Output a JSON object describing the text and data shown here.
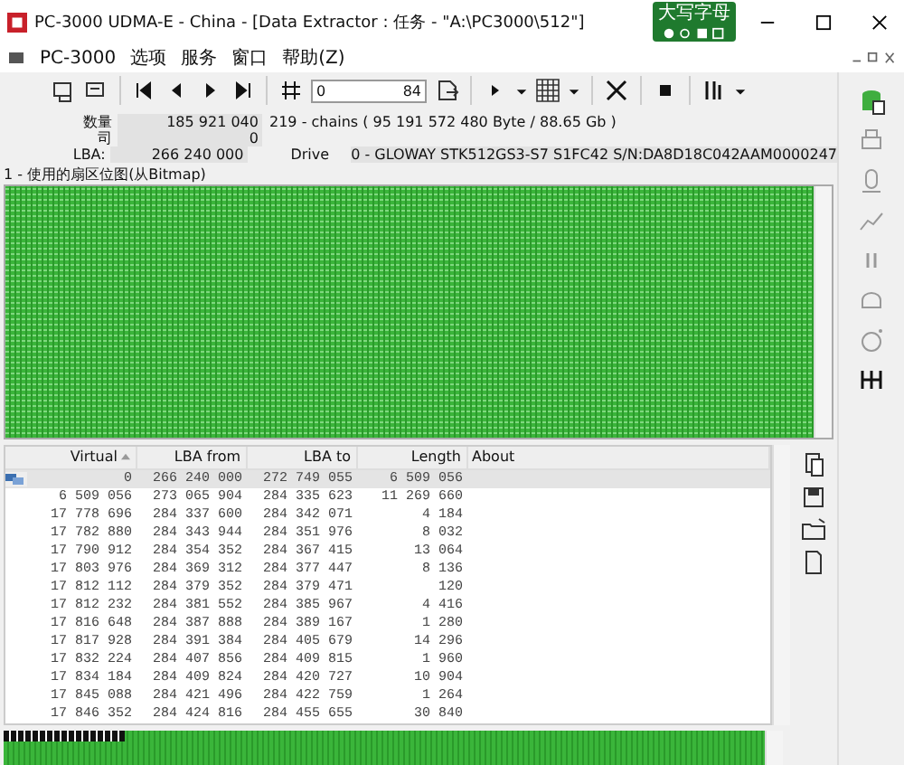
{
  "window": {
    "title": "PC-3000 UDMA-E - China - [Data Extractor : 任务 - \"A:\\PC3000\\512\"]"
  },
  "ime": {
    "label": "大写字母"
  },
  "menu": [
    "PC-3000",
    "选项",
    "服务",
    "窗口",
    "帮助(Z)"
  ],
  "toolbar": {
    "position_value": "0",
    "go_label": "84"
  },
  "info": [
    {
      "label": "数量",
      "value": "185 921 040",
      "extra": "219 - chains  ( 95 191 572 480 Byte /  88.65 Gb )"
    },
    {
      "label": "司",
      "value": "0"
    },
    {
      "label": "LBA:",
      "value": "266 240 000"
    }
  ],
  "drive": {
    "label": "Drive",
    "value": "0 - GLOWAY STK512GS3-S7 S1FC42 S/N:DA8D18C042AAM0000247"
  },
  "bitmap_panel": {
    "title": "1 - 使用的扇区位图(从Bitmap)"
  },
  "table": {
    "columns": [
      "Virtual",
      "LBA from",
      "LBA to",
      "Length",
      "About"
    ],
    "rows": [
      {
        "cells": [
          "0",
          "266 240 000",
          "272 749 055",
          "6 509 056",
          ""
        ],
        "selected": true
      },
      {
        "cells": [
          "6 509 056",
          "273 065 904",
          "284 335 623",
          "11 269 660",
          ""
        ],
        "selected": false
      },
      {
        "cells": [
          "17 778 696",
          "284 337 600",
          "284 342 071",
          "4 184",
          ""
        ],
        "selected": false
      },
      {
        "cells": [
          "17 782 880",
          "284 343 944",
          "284 351 976",
          "8 032",
          ""
        ],
        "selected": false
      },
      {
        "cells": [
          "17 790 912",
          "284 354 352",
          "284 367 415",
          "13 064",
          ""
        ],
        "selected": false
      },
      {
        "cells": [
          "17 803 976",
          "284 369 312",
          "284 377 447",
          "8 136",
          ""
        ],
        "selected": false
      },
      {
        "cells": [
          "17 812 112",
          "284 379 352",
          "284 379 471",
          "120",
          ""
        ],
        "selected": false
      },
      {
        "cells": [
          "17 812 232",
          "284 381 552",
          "284 385 967",
          "4 416",
          ""
        ],
        "selected": false
      },
      {
        "cells": [
          "17 816 648",
          "284 387 888",
          "284 389 167",
          "1 280",
          ""
        ],
        "selected": false
      },
      {
        "cells": [
          "17 817 928",
          "284 391 384",
          "284 405 679",
          "14 296",
          ""
        ],
        "selected": false
      },
      {
        "cells": [
          "17 832 224",
          "284 407 856",
          "284 409 815",
          "1 960",
          ""
        ],
        "selected": false
      },
      {
        "cells": [
          "17 834 184",
          "284 409 824",
          "284 420 727",
          "10 904",
          ""
        ],
        "selected": false
      },
      {
        "cells": [
          "17 845 088",
          "284 421 496",
          "284 422 759",
          "1 264",
          ""
        ],
        "selected": false
      },
      {
        "cells": [
          "17 846 352",
          "284 424 816",
          "284 455 655",
          "30 840",
          ""
        ],
        "selected": false
      }
    ]
  },
  "bottom_bitmap": {
    "level": 0.16
  }
}
